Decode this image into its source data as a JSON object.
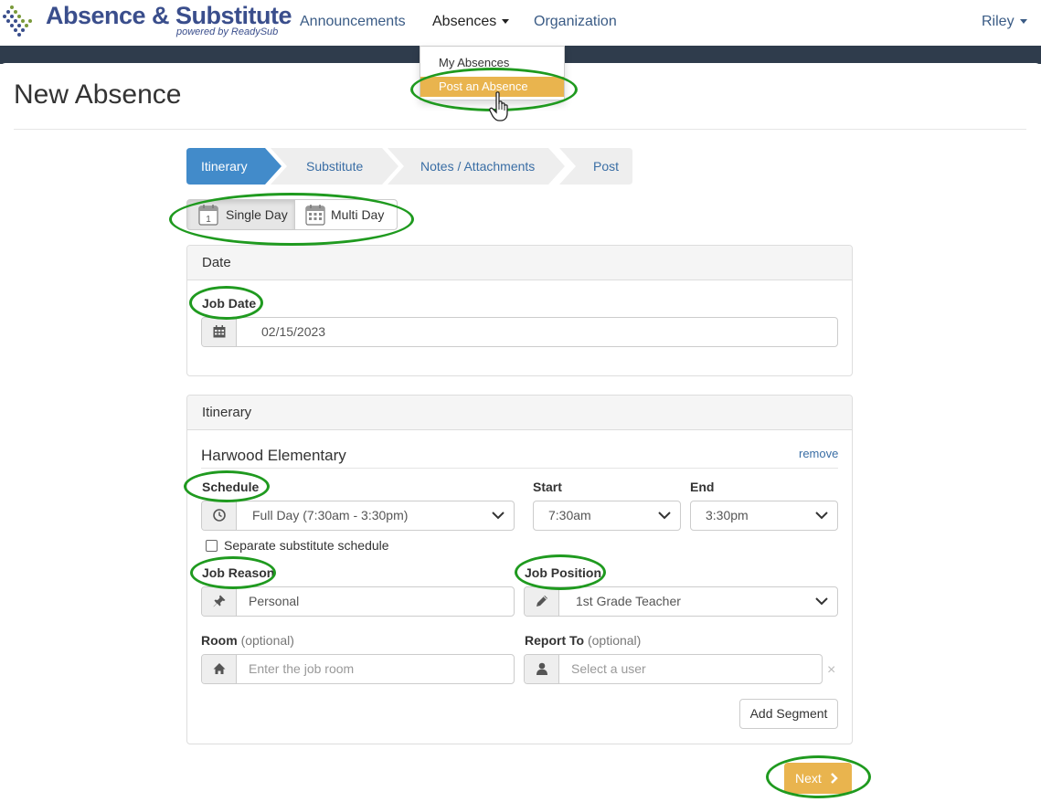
{
  "brand": {
    "title": "Absence & Substitute",
    "subtitle": "powered by ReadySub"
  },
  "nav": {
    "announcements": "Announcements",
    "absences": "Absences",
    "organization": "Organization",
    "user": "Riley"
  },
  "dropdown": {
    "items": [
      "My Absences",
      "Post an Absence"
    ],
    "highlighted": "Post an Absence"
  },
  "page": {
    "title": "New Absence"
  },
  "wizard": {
    "steps": [
      "Itinerary",
      "Substitute",
      "Notes / Attachments",
      "Post"
    ],
    "active": "Itinerary"
  },
  "day_toggle": {
    "single": "Single Day",
    "multi": "Multi Day",
    "selected": "Single Day",
    "single_icon_day": "1"
  },
  "date_panel": {
    "heading": "Date",
    "job_date_label": "Job Date",
    "job_date_value": "02/15/2023"
  },
  "itinerary_panel": {
    "heading": "Itinerary",
    "school": "Harwood Elementary",
    "remove_link": "remove",
    "schedule_label": "Schedule",
    "schedule_value": "Full Day (7:30am - 3:30pm)",
    "start_label": "Start",
    "start_value": "7:30am",
    "end_label": "End",
    "end_value": "3:30pm",
    "separate_schedule_label": "Separate substitute schedule",
    "separate_schedule_checked": false,
    "job_reason_label": "Job Reason",
    "job_reason_value": "Personal",
    "job_position_label": "Job Position",
    "job_position_value": "1st Grade Teacher",
    "room_label": "Room",
    "room_optional": "(optional)",
    "room_placeholder": "Enter the job room",
    "report_to_label": "Report To",
    "report_to_optional": "(optional)",
    "report_to_placeholder": "Select a user",
    "clear_symbol": "×",
    "add_segment": "Add Segment"
  },
  "actions": {
    "next": "Next"
  },
  "colors": {
    "brand_blue": "#3a4e8c",
    "nav_link": "#3a5b85",
    "dark_bar": "#2f3c4c",
    "wizard_active": "#428bca",
    "wizard_inactive": "#eeeeee",
    "accent_yellow": "#e9b44e",
    "annotation_green": "#1f9a1f"
  }
}
